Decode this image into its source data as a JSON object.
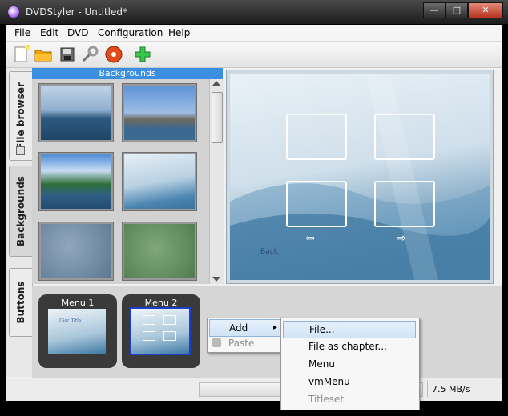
{
  "window": {
    "title": "DVDStyler - Untitled*",
    "controls": {
      "minimize": "—",
      "maximize": "□",
      "close": "✕"
    }
  },
  "menubar": [
    "File",
    "Edit",
    "DVD",
    "Configuration",
    "Help"
  ],
  "toolbar": {
    "icons": [
      "new-document-icon",
      "open-folder-icon",
      "save-icon",
      "settings-wrench-icon",
      "burn-dvd-icon",
      "add-plus-icon"
    ]
  },
  "sidetabs": [
    "File browser",
    "Backgrounds",
    "Buttons"
  ],
  "backgrounds": {
    "header": "Backgrounds"
  },
  "preview": {
    "back_label": "Back",
    "arrow_left": "⇦",
    "arrow_right": "⇨"
  },
  "menus": {
    "items": [
      {
        "label": "Menu 1",
        "inner_title": "Disc Title"
      },
      {
        "label": "Menu 2"
      }
    ]
  },
  "statusbar": {
    "speed": "7.5 MB/s"
  },
  "context_menu": {
    "items": [
      {
        "label": "Add",
        "has_submenu": true,
        "highlighted": true
      },
      {
        "label": "Paste",
        "disabled": true
      }
    ],
    "submenu_arrow": "▸",
    "submenu": [
      {
        "label": "File...",
        "highlighted": true
      },
      {
        "label": "File as chapter..."
      },
      {
        "label": "Menu"
      },
      {
        "label": "vmMenu"
      },
      {
        "label": "Titleset",
        "disabled": true
      }
    ]
  },
  "colors": {
    "accent": "#3a8fe0",
    "selection": "#1c3ec9"
  }
}
